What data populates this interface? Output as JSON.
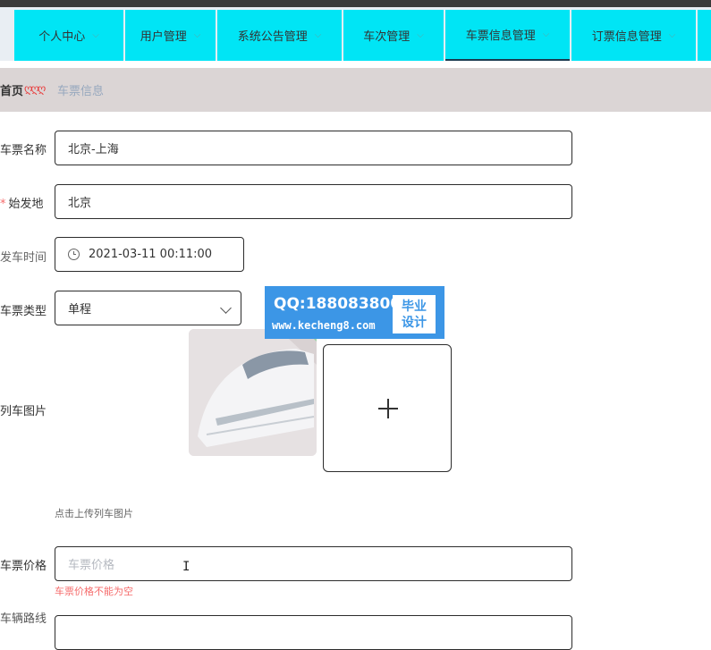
{
  "nav": {
    "items": [
      {
        "label": "个人中心"
      },
      {
        "label": "用户管理"
      },
      {
        "label": "系统公告管理"
      },
      {
        "label": "车次管理"
      },
      {
        "label": "车票信息管理"
      },
      {
        "label": "订票信息管理"
      }
    ],
    "active_index": 4
  },
  "breadcrumb": {
    "home": "首页",
    "separator": "ღღღ",
    "current": "车票信息"
  },
  "form": {
    "ticket_name": {
      "label": "车票名称",
      "value": "北京-上海"
    },
    "origin": {
      "label": "始发地",
      "required_mark": "*",
      "value": "北京"
    },
    "depart_time": {
      "label": "发车时间",
      "value": "2021-03-11 00:11:00"
    },
    "ticket_type": {
      "label": "车票类型",
      "value": "单程"
    },
    "image": {
      "label": "列车图片",
      "hint": "点击上传列车图片"
    },
    "price": {
      "label": "车票价格",
      "placeholder": "车票价格",
      "error": "车票价格不能为空"
    },
    "route": {
      "label": "车辆路线"
    }
  },
  "watermark": {
    "qq": "QQ:188083800",
    "site": "www.kecheng8.com",
    "tag_line1": "毕业",
    "tag_line2": "设计"
  },
  "colors": {
    "nav_bg": "#00e5f5",
    "crumb_bg": "#dbd5d5",
    "error": "#f56c6c",
    "watermark": "#3c96e6"
  }
}
